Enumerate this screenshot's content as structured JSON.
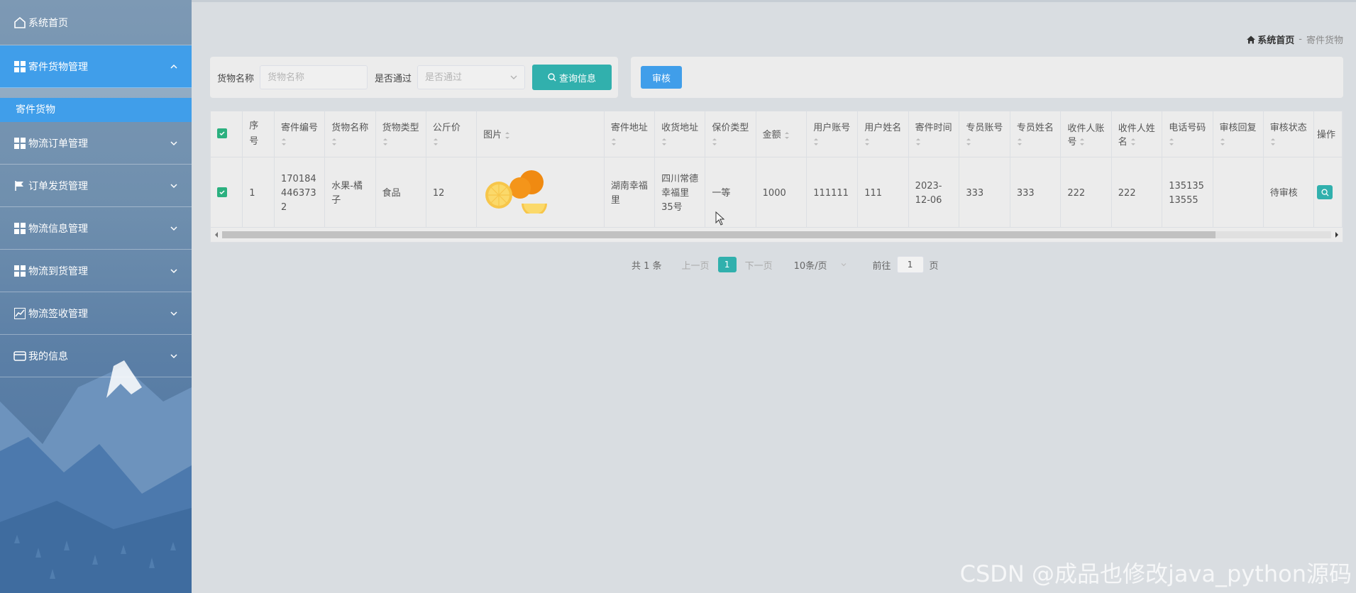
{
  "sidebar": {
    "items": [
      {
        "label": "系统首页",
        "icon": "home-icon"
      },
      {
        "label": "寄件货物管理",
        "icon": "grid-icon",
        "open": true,
        "children": [
          {
            "label": "寄件货物"
          }
        ]
      },
      {
        "label": "物流订单管理",
        "icon": "grid-icon"
      },
      {
        "label": "订单发货管理",
        "icon": "flag-icon"
      },
      {
        "label": "物流信息管理",
        "icon": "grid-icon"
      },
      {
        "label": "物流到货管理",
        "icon": "grid-icon"
      },
      {
        "label": "物流签收管理",
        "icon": "chart-icon"
      },
      {
        "label": "我的信息",
        "icon": "wallet-icon"
      }
    ]
  },
  "breadcrumb": {
    "home": "系统首页",
    "separator": "-",
    "current": "寄件货物"
  },
  "search": {
    "name_label": "货物名称",
    "name_placeholder": "货物名称",
    "pass_label": "是否通过",
    "pass_placeholder": "是否通过",
    "search_button": "查询信息"
  },
  "actions": {
    "audit_button": "审核"
  },
  "table": {
    "headers": [
      "序号",
      "寄件编号",
      "货物名称",
      "货物类型",
      "公斤价",
      "图片",
      "寄件地址",
      "收货地址",
      "保价类型",
      "金额",
      "用户账号",
      "用户姓名",
      "寄件时间",
      "专员账号",
      "专员姓名",
      "收件人账号",
      "收件人姓名",
      "电话号码",
      "审核回复",
      "审核状态",
      "操作"
    ],
    "rows": [
      [
        "1",
        "1701844463732",
        "水果-橘子",
        "食品",
        "12",
        "",
        "湖南幸福里",
        "四川常德幸福里35号",
        "一等",
        "1000",
        "111111",
        "111",
        "2023-12-06",
        "333",
        "333",
        "222",
        "222",
        "13513513555",
        "",
        "待审核",
        ""
      ]
    ]
  },
  "pager": {
    "total": "共 1 条",
    "prev": "上一页",
    "page": "1",
    "next": "下一页",
    "size": "10条/页",
    "goto_label": "前往",
    "goto_value": "1",
    "goto_suffix": "页"
  },
  "watermark": "CSDN @成品也修改java_python源码",
  "colors": {
    "accent": "#409eea",
    "teal": "#31b0ad",
    "checkbox": "#2bb07f"
  }
}
